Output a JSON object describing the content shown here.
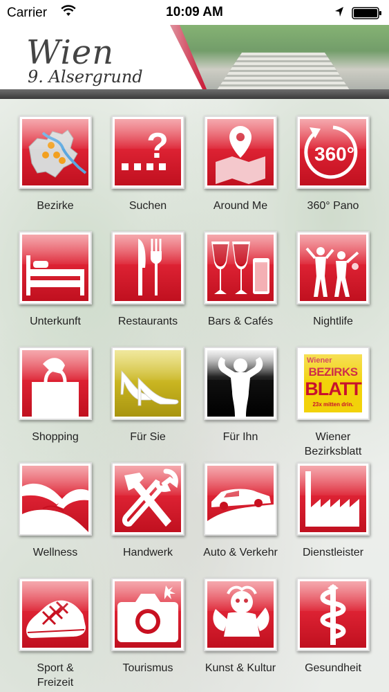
{
  "status_bar": {
    "carrier": "Carrier",
    "time": "10:09 AM"
  },
  "header": {
    "title": "Wien",
    "subtitle": "9. Alsergrund"
  },
  "tiles": [
    {
      "label": "Bezirke",
      "icon": "district-map-icon"
    },
    {
      "label": "Suchen",
      "icon": "search-question-icon"
    },
    {
      "label": "Around Me",
      "icon": "map-pin-icon"
    },
    {
      "label": "360° Pano",
      "icon": "360-rotate-icon"
    },
    {
      "label": "Unterkunft",
      "icon": "bed-icon"
    },
    {
      "label": "Restaurants",
      "icon": "knife-fork-icon"
    },
    {
      "label": "Bars & Cafés",
      "icon": "drinks-icon"
    },
    {
      "label": "Nightlife",
      "icon": "dancers-icon"
    },
    {
      "label": "Shopping",
      "icon": "shopping-bag-icon"
    },
    {
      "label": "Für Sie",
      "icon": "high-heels-icon"
    },
    {
      "label": "Für Ihn",
      "icon": "muscle-man-icon"
    },
    {
      "label": "Wiener\nBezirksblatt",
      "icon": "bezirksblatt-logo"
    },
    {
      "label": "Wellness",
      "icon": "massage-icon"
    },
    {
      "label": "Handwerk",
      "icon": "hammer-wrench-icon"
    },
    {
      "label": "Auto & Verkehr",
      "icon": "car-icon"
    },
    {
      "label": "Dienstleister",
      "icon": "factory-icon"
    },
    {
      "label": "Sport &\nFreizeit",
      "icon": "sneaker-icon"
    },
    {
      "label": "Tourismus",
      "icon": "camera-icon"
    },
    {
      "label": "Kunst & Kultur",
      "icon": "cherub-icon"
    },
    {
      "label": "Gesundheit",
      "icon": "aesculapius-icon"
    }
  ],
  "bezirksblatt": {
    "top": "Wiener",
    "line1": "BEZIRKS",
    "line2": "BLATT",
    "tagline": "23x mitten drin."
  },
  "colors": {
    "tile_red": "#dd2233",
    "tile_gold": "#c8b420",
    "header_text": "#444444"
  }
}
